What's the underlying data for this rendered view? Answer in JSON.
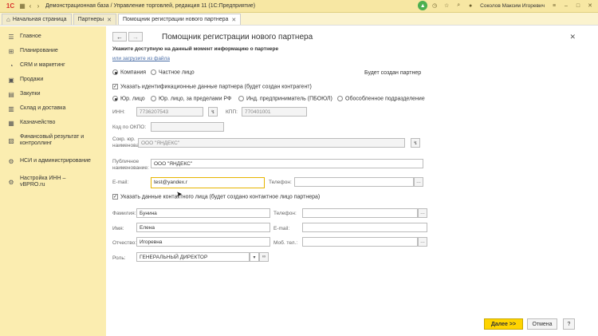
{
  "app": {
    "title": "Демонстрационная база / Управление торговлей, редакция 11  (1С:Предприятие)",
    "user": "Соколов Максим Игоревич"
  },
  "tabs": [
    {
      "label": "Начальная страница"
    },
    {
      "label": "Партнеры"
    },
    {
      "label": "Помощник регистрации нового партнера"
    }
  ],
  "sidebar": {
    "items": [
      {
        "label": "Главное",
        "icon": "menu-icon"
      },
      {
        "label": "Планирование",
        "icon": "planning-icon"
      },
      {
        "label": "CRM и маркетинг",
        "icon": "crm-icon"
      },
      {
        "label": "Продажи",
        "icon": "sales-icon"
      },
      {
        "label": "Закупки",
        "icon": "purchases-icon"
      },
      {
        "label": "Склад и доставка",
        "icon": "warehouse-icon"
      },
      {
        "label": "Казначейство",
        "icon": "treasury-icon"
      },
      {
        "label": "Финансовый результат и контроллинг",
        "icon": "finance-icon"
      },
      {
        "label": "НСИ и администрирование",
        "icon": "settings-icon"
      },
      {
        "label": "Настройка ИНН – vBPRO.ru",
        "icon": "inn-icon"
      }
    ]
  },
  "form": {
    "title": "Помощник регистрации нового партнера",
    "hint": "Укажите доступную на данный момент информацию о партнере",
    "load_link": "или загрузите из файла",
    "partner_type": {
      "company": "Компания",
      "person": "Частное лицо",
      "status": "Будет создан партнер"
    },
    "identify_checkbox": "Указать идентификационные данные партнера (будет создан контрагент)",
    "entity_types": [
      "Юр. лицо",
      "Юр. лицо, за пределами РФ",
      "Инд. предприниматель (ПБОЮЛ)",
      "Обособленное подразделение"
    ],
    "inn": {
      "label": "ИНН:",
      "value": "7736207543"
    },
    "kpp": {
      "label": "КПП:",
      "value": "770401001"
    },
    "okpo": {
      "label": "Код по ОКПО:",
      "value": ""
    },
    "short_name": {
      "label": "Сокр. юр. наименование:",
      "value": "ООО \"ЯНДЕКС\""
    },
    "public_name": {
      "label": "Публичное наименование:",
      "value": "ООО \"ЯНДЕКС\""
    },
    "email": {
      "label": "E-mail:",
      "value": "test@yandex.r"
    },
    "phone": {
      "label": "Телефон:",
      "value": ""
    },
    "contact_checkbox": "Указать данные контактного лица (будет создано контактное лицо партнера)",
    "last_name": {
      "label": "Фамилия:",
      "value": "Бунина"
    },
    "first_name": {
      "label": "Имя:",
      "value": "Елена"
    },
    "middle_name": {
      "label": "Отчество:",
      "value": "Игоревна"
    },
    "role": {
      "label": "Роль:",
      "value": "ГЕНЕРАЛЬНЫЙ ДИРЕКТОР"
    },
    "contact_phone": {
      "label": "Телефон:",
      "value": ""
    },
    "contact_email": {
      "label": "E-mail:",
      "value": ""
    },
    "mobile": {
      "label": "Моб. тел.:",
      "value": ""
    }
  },
  "buttons": {
    "next": "Далее >>",
    "cancel": "Отмена",
    "help": "?"
  },
  "colors": {
    "titlebar": "#f7e7a3",
    "sidebar": "#fbedb0",
    "accent": "#ffd400"
  }
}
